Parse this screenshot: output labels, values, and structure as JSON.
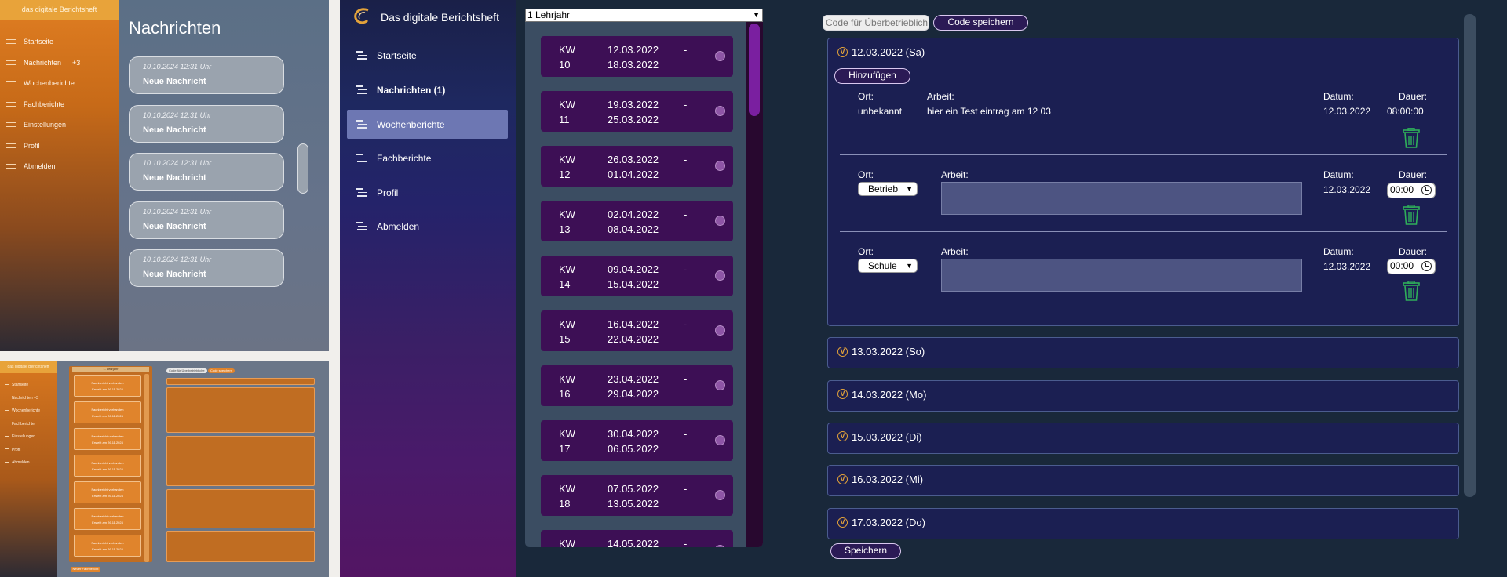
{
  "panel_a": {
    "brand": "das digitale Berichtsheft",
    "nav": [
      {
        "label": "Startseite",
        "badge": ""
      },
      {
        "label": "Nachrichten",
        "badge": "+3"
      },
      {
        "label": "Wochenberichte",
        "badge": ""
      },
      {
        "label": "Fachberichte",
        "badge": ""
      },
      {
        "label": "Einstellungen",
        "badge": ""
      },
      {
        "label": "Profil",
        "badge": ""
      },
      {
        "label": "Abmelden",
        "badge": ""
      }
    ],
    "title": "Nachrichten",
    "messages": [
      {
        "time": "10.10.2024  12:31 Uhr",
        "subject": "Neue Nachricht"
      },
      {
        "time": "10.10.2024  12:31 Uhr",
        "subject": "Neue Nachricht"
      },
      {
        "time": "10.10.2024  12:31 Uhr",
        "subject": "Neue Nachricht"
      },
      {
        "time": "10.10.2024  12:31 Uhr",
        "subject": "Neue Nachricht"
      },
      {
        "time": "10.10.2024  12:31 Uhr",
        "subject": "Neue Nachricht"
      }
    ]
  },
  "panel_b": {
    "brand": "das digitale Berichtsheft",
    "nav": [
      "Startseite",
      "Nachrichten  +3",
      "Wochenberichte",
      "Fachberichte",
      "Einstellungen",
      "Profil",
      "Abmelden"
    ],
    "year_select": "1. Lehrjahr",
    "cards": [
      {
        "title": "Fachbericht vorhanden",
        "sub": "Erstellt am 26.11.2024"
      },
      {
        "title": "Fachbericht vorhanden",
        "sub": "Erstellt am 26.11.2024"
      },
      {
        "title": "Fachbericht vorhanden",
        "sub": "Erstellt am 26.11.2024"
      },
      {
        "title": "Fachbericht vorhanden",
        "sub": "Erstellt am 26.11.2024"
      },
      {
        "title": "Fachbericht vorhanden",
        "sub": "Erstellt am 26.11.2024"
      },
      {
        "title": "Fachbericht vorhanden",
        "sub": "Erstellt am 26.11.2024"
      },
      {
        "title": "Fachbericht vorhanden",
        "sub": "Erstellt am 26.11.2024"
      }
    ],
    "code_input": "Code für Überbetriebliche",
    "code_save": "Code speichern",
    "bottom_button": "Neuer Fachbericht"
  },
  "panel_c": {
    "brand": "Das digitale Berichtsheft",
    "nav": [
      {
        "label": "Startseite",
        "bold": false,
        "active": false
      },
      {
        "label": "Nachrichten (1)",
        "bold": true,
        "active": false
      },
      {
        "label": "Wochenberichte",
        "bold": false,
        "active": true
      },
      {
        "label": "Fachberichte",
        "bold": false,
        "active": false
      },
      {
        "label": "Profil",
        "bold": false,
        "active": false
      },
      {
        "label": "Abmelden",
        "bold": false,
        "active": false
      }
    ],
    "year_select": "1 Lehrjahr",
    "weeks": [
      {
        "kw": "KW",
        "num": "10",
        "start": "12.03.2022",
        "end": "18.03.2022"
      },
      {
        "kw": "KW",
        "num": "11",
        "start": "19.03.2022",
        "end": "25.03.2022"
      },
      {
        "kw": "KW",
        "num": "12",
        "start": "26.03.2022",
        "end": "01.04.2022"
      },
      {
        "kw": "KW",
        "num": "13",
        "start": "02.04.2022",
        "end": "08.04.2022"
      },
      {
        "kw": "KW",
        "num": "14",
        "start": "09.04.2022",
        "end": "15.04.2022"
      },
      {
        "kw": "KW",
        "num": "15",
        "start": "16.04.2022",
        "end": "22.04.2022"
      },
      {
        "kw": "KW",
        "num": "16",
        "start": "23.04.2022",
        "end": "29.04.2022"
      },
      {
        "kw": "KW",
        "num": "17",
        "start": "30.04.2022",
        "end": "06.05.2022"
      },
      {
        "kw": "KW",
        "num": "18",
        "start": "07.05.2022",
        "end": "13.05.2022"
      },
      {
        "kw": "KW",
        "num": "",
        "start": "14.05.2022",
        "end": ""
      }
    ],
    "week_dash": "-",
    "code_placeholder": "Code für Überbetrieblich",
    "code_save": "Code speichern",
    "open_day": {
      "title": "12.03.2022 (Sa)",
      "add_button": "Hinzufügen",
      "labels": {
        "ort": "Ort:",
        "arbeit": "Arbeit:",
        "datum": "Datum:",
        "dauer": "Dauer:"
      },
      "saved_entry": {
        "ort": "unbekannt",
        "arbeit": "hier ein Test eintrag am 12 03",
        "datum": "12.03.2022",
        "dauer": "08:00:00"
      },
      "new_entries": [
        {
          "ort": "Betrieb",
          "datum": "12.03.2022",
          "dauer": "00:00"
        },
        {
          "ort": "Schule",
          "datum": "12.03.2022",
          "dauer": "00:00"
        }
      ]
    },
    "days": [
      "13.03.2022 (So)",
      "14.03.2022 (Mo)",
      "15.03.2022 (Di)",
      "16.03.2022 (Mi)",
      "17.03.2022 (Do)"
    ],
    "expand_symbol": "V",
    "save_button": "Speichern",
    "colors": {
      "accent": "#e3a23a",
      "trash": "#2fae5a",
      "week_card": "#3d0f55",
      "nav_active": "#6d77b3"
    }
  }
}
